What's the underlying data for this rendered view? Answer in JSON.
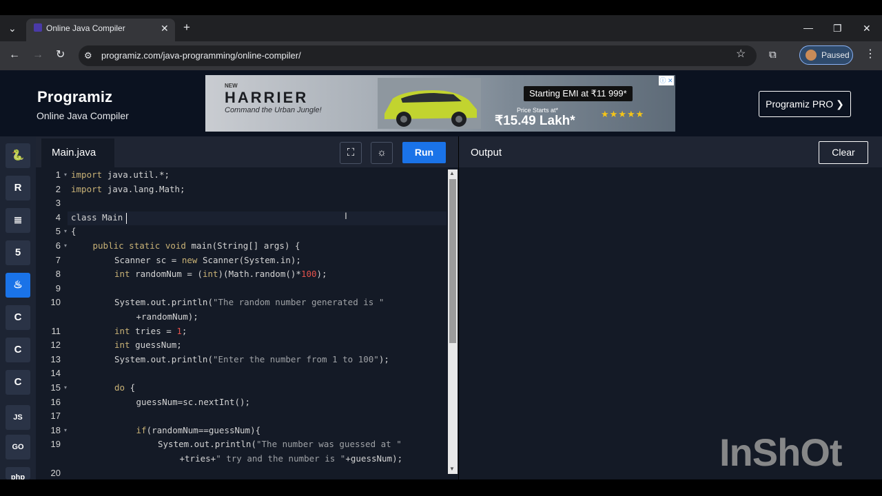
{
  "browser": {
    "tab_title": "Online Java Compiler",
    "url": "programiz.com/java-programming/online-compiler/",
    "profile_status": "Paused"
  },
  "site": {
    "logo_text": "Programiz",
    "subtitle": "Online Java Compiler",
    "pro_button": "Programiz PRO ❯"
  },
  "ad": {
    "brand_small": "NEW",
    "brand": "HARRIER",
    "tagline": "Command the Urban Jungle!",
    "emi": "Starting EMI at ₹11 999*",
    "price_label": "Price Starts at*",
    "price": "₹15.49 Lakh*",
    "stars": "★★★★★"
  },
  "rail": [
    {
      "name": "python-icon",
      "glyph": "🐍"
    },
    {
      "name": "r-icon",
      "glyph": "R"
    },
    {
      "name": "sql-icon",
      "glyph": "≣"
    },
    {
      "name": "html-icon",
      "glyph": "5"
    },
    {
      "name": "java-icon",
      "glyph": "♨",
      "active": true
    },
    {
      "name": "c-icon",
      "glyph": "C"
    },
    {
      "name": "cpp-icon",
      "glyph": "C"
    },
    {
      "name": "csharp-icon",
      "glyph": "C"
    },
    {
      "name": "js-icon",
      "glyph": "JS"
    },
    {
      "name": "go-icon",
      "glyph": "GO"
    },
    {
      "name": "php-icon",
      "glyph": "php"
    }
  ],
  "editor": {
    "file_name": "Main.java",
    "run_label": "Run",
    "lines": [
      {
        "n": "1",
        "fold": true,
        "indent": 0,
        "parts": [
          [
            "kw",
            "import"
          ],
          [
            "",
            "java.util.*;"
          ]
        ]
      },
      {
        "n": "2",
        "indent": 0,
        "parts": [
          [
            "kw",
            "import"
          ],
          [
            "",
            "java.lang.Math;"
          ]
        ]
      },
      {
        "n": "3",
        "indent": 0,
        "parts": []
      },
      {
        "n": "4",
        "indent": 0,
        "parts": [
          [
            "",
            "class Main"
          ]
        ]
      },
      {
        "n": "5",
        "fold": true,
        "indent": 0,
        "parts": [
          [
            "",
            "{"
          ]
        ]
      },
      {
        "n": "6",
        "fold": true,
        "indent": 1,
        "parts": [
          [
            "kw",
            "public static void"
          ],
          [
            "",
            " main(String[] args) {"
          ]
        ]
      },
      {
        "n": "7",
        "indent": 2,
        "parts": [
          [
            "",
            "Scanner sc = "
          ],
          [
            "kw",
            "new"
          ],
          [
            "",
            " Scanner(System.in);"
          ]
        ]
      },
      {
        "n": "8",
        "indent": 2,
        "parts": [
          [
            "kw",
            "int"
          ],
          [
            "",
            " randomNum = ("
          ],
          [
            "kw",
            "int"
          ],
          [
            "",
            ")(Math.random()*"
          ],
          [
            "num",
            "100"
          ],
          [
            "",
            ");"
          ]
        ]
      },
      {
        "n": "9",
        "indent": 0,
        "parts": []
      },
      {
        "n": "10",
        "indent": 2,
        "parts": [
          [
            "",
            "System.out.println("
          ],
          [
            "str",
            "\"The random number generated is \""
          ]
        ]
      },
      {
        "n": "",
        "indent": 3,
        "parts": [
          [
            "",
            "+randomNum);"
          ]
        ]
      },
      {
        "n": "11",
        "indent": 2,
        "parts": [
          [
            "kw",
            "int"
          ],
          [
            "",
            " tries = "
          ],
          [
            "num",
            "1"
          ],
          [
            "",
            ";"
          ]
        ]
      },
      {
        "n": "12",
        "indent": 2,
        "parts": [
          [
            "kw",
            "int"
          ],
          [
            "",
            " guessNum;"
          ]
        ]
      },
      {
        "n": "13",
        "indent": 2,
        "parts": [
          [
            "",
            "System.out.println("
          ],
          [
            "str",
            "\"Enter the number from 1 to 100\""
          ],
          [
            "",
            ");"
          ]
        ]
      },
      {
        "n": "14",
        "indent": 0,
        "parts": []
      },
      {
        "n": "15",
        "fold": true,
        "indent": 2,
        "parts": [
          [
            "kw",
            "do"
          ],
          [
            "",
            " {"
          ]
        ]
      },
      {
        "n": "16",
        "indent": 3,
        "parts": [
          [
            "",
            "guessNum=sc.nextInt();"
          ]
        ]
      },
      {
        "n": "17",
        "indent": 0,
        "parts": []
      },
      {
        "n": "18",
        "fold": true,
        "indent": 3,
        "parts": [
          [
            "kw",
            "if"
          ],
          [
            "",
            "(randomNum==guessNum){"
          ]
        ]
      },
      {
        "n": "19",
        "indent": 4,
        "parts": [
          [
            "",
            "System.out.println("
          ],
          [
            "str",
            "\"The number was guessed at \""
          ]
        ]
      },
      {
        "n": "",
        "indent": 5,
        "parts": [
          [
            "",
            "+tries+"
          ],
          [
            "str",
            "\" try and the number is \""
          ],
          [
            "",
            "+guessNum);"
          ]
        ]
      },
      {
        "n": "20",
        "indent": 0,
        "parts": []
      }
    ]
  },
  "output": {
    "label": "Output",
    "clear_label": "Clear"
  },
  "watermark": "InShOt"
}
